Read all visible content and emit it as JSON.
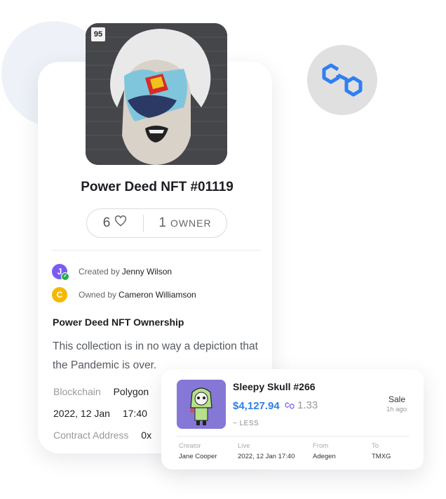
{
  "nft": {
    "badge": "95",
    "title": "Power Deed NFT #01119",
    "likes": "6",
    "owners_count": "1",
    "owners_label": "OWNER",
    "created_prefix": "Created by",
    "creator": "Jenny Wilson",
    "creator_initial": "J",
    "owned_prefix": "Owned by",
    "owner": "Cameron Williamson",
    "owner_initial": "C",
    "section_title": "Power Deed NFT Ownership",
    "description": "This collection is in no way a depiction that the Pandemic is over.",
    "blockchain_label": "Blockchain",
    "blockchain_value": "Polygon",
    "date": "2022, 12 Jan",
    "time": "17:40",
    "contract_label": "Contract Address",
    "contract_value": "0x"
  },
  "transaction": {
    "name": "Sleepy Skull #266",
    "price_usd": "$4,127.94",
    "price_token": "1.33",
    "toggle": "~ LESS",
    "type": "Sale",
    "ago": "1h ago",
    "columns": [
      {
        "key": "Creator",
        "value": "Jane Cooper"
      },
      {
        "key": "Live",
        "value": "2022, 12 Jan 17:40"
      },
      {
        "key": "From",
        "value": "Adegen"
      },
      {
        "key": "To",
        "value": "TMXG"
      }
    ]
  },
  "colors": {
    "accent_blue": "#2e7fe6",
    "polygon_blue": "#2f7ff3",
    "creator_avatar": "#7b5cf0",
    "owner_avatar": "#f5b800",
    "thumb_bg": "#8577d6"
  },
  "icons": [
    "heart-icon",
    "polygon-logo-icon",
    "verified-check-icon",
    "link-token-icon"
  ]
}
